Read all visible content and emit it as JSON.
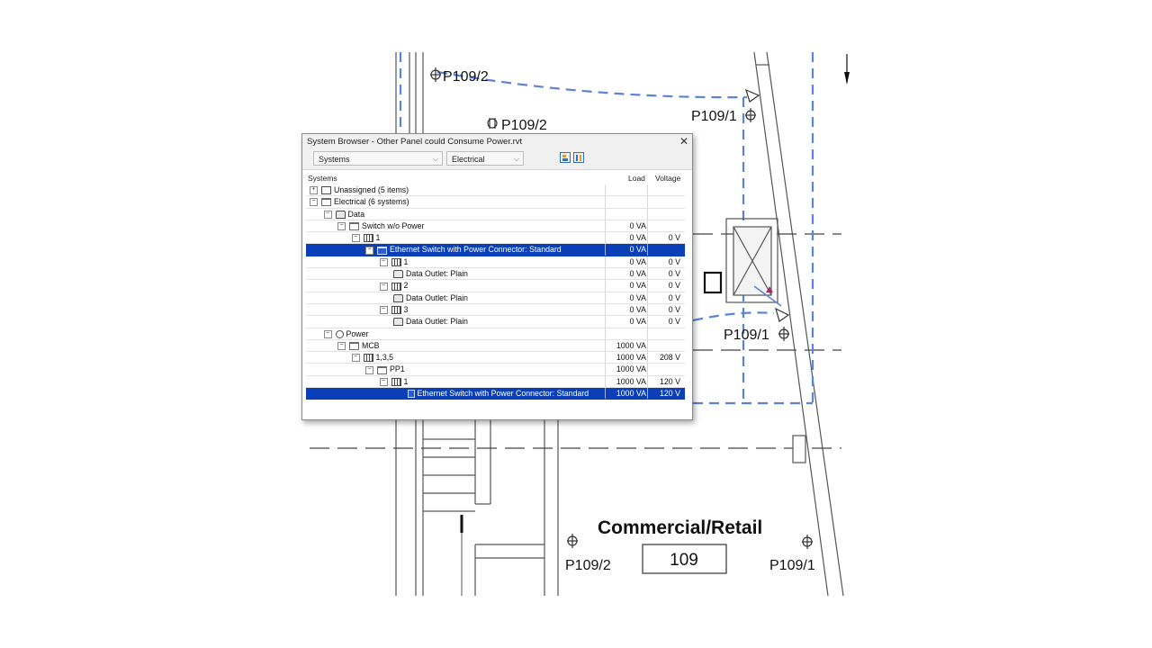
{
  "drawing": {
    "room_name": "Commercial/Retail",
    "room_number": "109",
    "tags": {
      "top_left": "P109/2",
      "top_mid": "P109/2",
      "top_right": "P109/1",
      "mid_right": "P109/1",
      "bottom_left": "P109/2",
      "bottom_right": "P109/1"
    }
  },
  "window": {
    "title": "System Browser - Other Panel could Consume Power.rvt",
    "close_glyph": "✕",
    "view_combo": "Systems",
    "discipline_combo": "Electrical",
    "headers": {
      "systems": "Systems",
      "load": "Load",
      "voltage": "Voltage"
    }
  },
  "rows": [
    {
      "indent": 0,
      "exp": "+",
      "icon": "unknown",
      "name": "Unassigned (5 items)",
      "load": "",
      "voltage": "",
      "selected": false
    },
    {
      "indent": 0,
      "exp": "−",
      "icon": "folder",
      "name": "Electrical (6 systems)",
      "load": "",
      "voltage": "",
      "selected": false
    },
    {
      "indent": 1,
      "exp": "−",
      "icon": "outlet",
      "name": "Data",
      "load": "",
      "voltage": "",
      "selected": false
    },
    {
      "indent": 2,
      "exp": "−",
      "icon": "folder",
      "name": "Switch w/o Power",
      "load": "0 VA",
      "voltage": "",
      "selected": false
    },
    {
      "indent": 3,
      "exp": "−",
      "icon": "panel",
      "name": "1",
      "load": "0 VA",
      "voltage": "0 V",
      "selected": false
    },
    {
      "indent": 4,
      "exp": "−",
      "icon": "folder",
      "name": "Ethernet Switch with Power Connector: Standard",
      "load": "0 VA",
      "voltage": "",
      "selected": true
    },
    {
      "indent": 5,
      "exp": "−",
      "icon": "panel",
      "name": "1",
      "load": "0 VA",
      "voltage": "0 V",
      "selected": false
    },
    {
      "indent": 6,
      "exp": "",
      "icon": "outlet",
      "name": "Data Outlet: Plain",
      "load": "0 VA",
      "voltage": "0 V",
      "selected": false
    },
    {
      "indent": 5,
      "exp": "−",
      "icon": "panel",
      "name": "2",
      "load": "0 VA",
      "voltage": "0 V",
      "selected": false
    },
    {
      "indent": 6,
      "exp": "",
      "icon": "outlet",
      "name": "Data Outlet: Plain",
      "load": "0 VA",
      "voltage": "0 V",
      "selected": false
    },
    {
      "indent": 5,
      "exp": "−",
      "icon": "panel",
      "name": "3",
      "load": "0 VA",
      "voltage": "0 V",
      "selected": false
    },
    {
      "indent": 6,
      "exp": "",
      "icon": "outlet",
      "name": "Data Outlet: Plain",
      "load": "0 VA",
      "voltage": "0 V",
      "selected": false
    },
    {
      "indent": 1,
      "exp": "−",
      "icon": "circuit",
      "name": "Power",
      "load": "",
      "voltage": "",
      "selected": false
    },
    {
      "indent": 2,
      "exp": "−",
      "icon": "folder",
      "name": "MCB",
      "load": "1000 VA",
      "voltage": "",
      "selected": false
    },
    {
      "indent": 3,
      "exp": "−",
      "icon": "panel",
      "name": "1,3,5",
      "load": "1000 VA",
      "voltage": "208 V",
      "selected": false
    },
    {
      "indent": 4,
      "exp": "−",
      "icon": "folder",
      "name": "PP1",
      "load": "1000 VA",
      "voltage": "",
      "selected": false
    },
    {
      "indent": 5,
      "exp": "−",
      "icon": "panel",
      "name": "1",
      "load": "1000 VA",
      "voltage": "120 V",
      "selected": false
    },
    {
      "indent": 7,
      "exp": "",
      "icon": "device",
      "name": "Ethernet Switch with Power Connector: Standard",
      "load": "1000 VA",
      "voltage": "120 V",
      "selected": true
    }
  ]
}
